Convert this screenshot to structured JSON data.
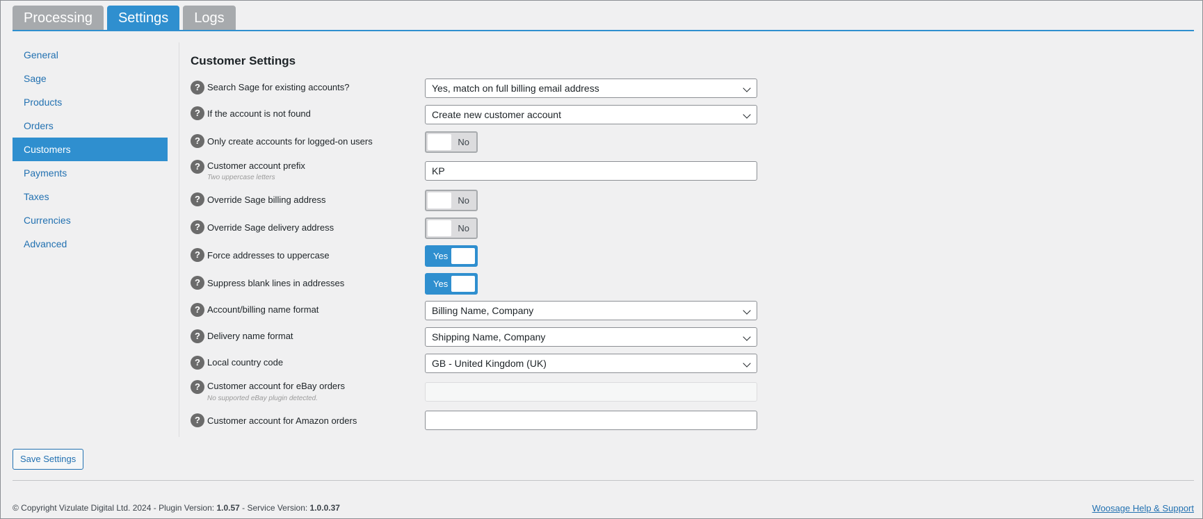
{
  "tabs": [
    "Processing",
    "Settings",
    "Logs"
  ],
  "sidebar": [
    "General",
    "Sage",
    "Products",
    "Orders",
    "Customers",
    "Payments",
    "Taxes",
    "Currencies",
    "Advanced"
  ],
  "section_title": "Customer Settings",
  "help_glyph": "?",
  "rows": {
    "search_sage": {
      "label": "Search Sage for existing accounts?",
      "value": "Yes, match on full billing email address"
    },
    "not_found": {
      "label": "If the account is not found",
      "value": "Create new customer account"
    },
    "only_logged_on": {
      "label": "Only create accounts for logged-on users",
      "value": "No"
    },
    "prefix": {
      "label": "Customer account prefix",
      "hint": "Two uppercase letters",
      "value": "KP"
    },
    "override_billing": {
      "label": "Override Sage billing address",
      "value": "No"
    },
    "override_delivery": {
      "label": "Override Sage delivery address",
      "value": "No"
    },
    "force_uppercase": {
      "label": "Force addresses to uppercase",
      "value": "Yes"
    },
    "suppress_blank": {
      "label": "Suppress blank lines in addresses",
      "value": "Yes"
    },
    "billing_name_format": {
      "label": "Account/billing name format",
      "value": "Billing Name, Company"
    },
    "delivery_name_format": {
      "label": "Delivery name format",
      "value": "Shipping Name, Company"
    },
    "country_code": {
      "label": "Local country code",
      "value": "GB - United Kingdom (UK)"
    },
    "ebay_account": {
      "label": "Customer account for eBay orders",
      "hint": "No supported eBay plugin detected.",
      "value": ""
    },
    "amazon_account": {
      "label": "Customer account for Amazon orders",
      "value": ""
    }
  },
  "save_label": "Save Settings",
  "footer": {
    "copyright": "© Copyright Vizulate Digital Ltd. 2024 - Plugin Version: ",
    "plugin_version": "1.0.57",
    "service_prefix": " - Service Version: ",
    "service_version": "1.0.0.37",
    "help_link": "Woosage Help & Support"
  },
  "colors": {
    "accent": "#2f8fcf",
    "tab_inactive": "#a7aaad",
    "link": "#2271b1",
    "background": "#f0f0f1"
  }
}
